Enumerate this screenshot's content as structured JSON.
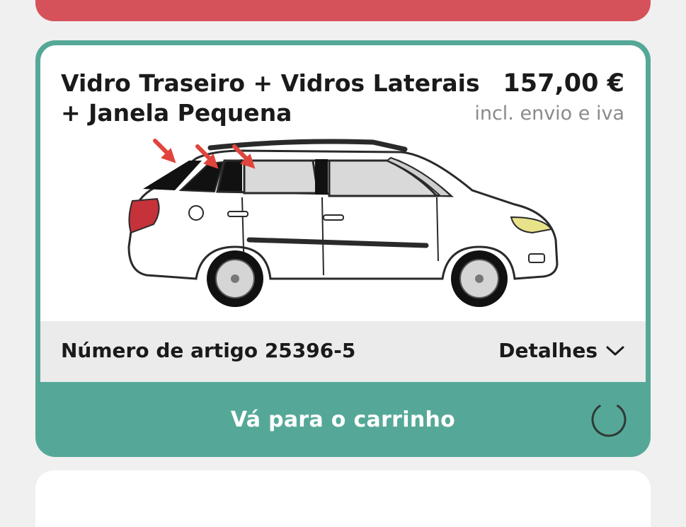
{
  "product": {
    "title_line1": "Vidro Traseiro + Vidros Laterais",
    "title_line2": "+ Janela Pequena",
    "price": "157,00 €",
    "price_note": "incl. envio e iva",
    "image_icon": "car-window-diagram-icon"
  },
  "article": {
    "number_label": "Número de artigo 25396-5",
    "details_label": "Detalhes",
    "details_icon": "chevron-down-icon"
  },
  "cart": {
    "button_label": "Vá para o carrinho",
    "spinner_icon": "loading-spinner-icon"
  },
  "colors": {
    "accent": "#55a897",
    "top_banner": "#d6525a",
    "arrow": "#e0443c"
  }
}
